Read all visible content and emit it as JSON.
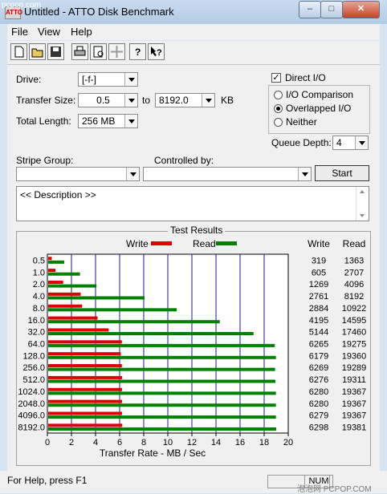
{
  "window": {
    "title": "Untitled - ATTO Disk Benchmark",
    "icon_text": "ATTO",
    "minimize": "–",
    "maximize": "□",
    "close": "✕"
  },
  "watermark_top": "pcpop.com",
  "menu": [
    "File",
    "View",
    "Help"
  ],
  "toolbar": {
    "icons": [
      "new-icon",
      "open-icon",
      "save-icon",
      "print-icon",
      "print-preview-icon",
      "move-icon",
      "help-icon",
      "context-help-icon"
    ]
  },
  "settings": {
    "drive_label": "Drive:",
    "drive_value": "[-f-]",
    "transfer_size_label": "Transfer Size:",
    "transfer_from": "0.5",
    "to_label": "to",
    "transfer_to": "8192.0",
    "kb_label": "KB",
    "total_length_label": "Total Length:",
    "total_length_value": "256 MB",
    "direct_io_label": "Direct I/O",
    "direct_io_checked": true,
    "io_comparison_label": "I/O Comparison",
    "overlapped_io_label": "Overlapped I/O",
    "neither_label": "Neither",
    "selected_mode": "overlapped",
    "queue_depth_label": "Queue Depth:",
    "queue_depth_value": "4",
    "stripe_group_label": "Stripe Group:",
    "stripe_group_value": "",
    "controlled_by_label": "Controlled by:",
    "controlled_by_value": "",
    "start_label": "Start",
    "description": "<< Description >>"
  },
  "results_title": "Test Results",
  "legend": {
    "write_label": "Write",
    "read_label": "Read"
  },
  "columns": {
    "write": "Write",
    "read": "Read"
  },
  "chart_data": {
    "type": "bar",
    "orientation": "horizontal",
    "categories": [
      "0.5",
      "1.0",
      "2.0",
      "4.0",
      "8.0",
      "16.0",
      "32.0",
      "64.0",
      "128.0",
      "256.0",
      "512.0",
      "1024.0",
      "2048.0",
      "4096.0",
      "8192.0"
    ],
    "series": [
      {
        "name": "Write",
        "color": "#e00000",
        "values": [
          0.3,
          0.6,
          1.24,
          2.7,
          2.82,
          4.1,
          5.02,
          6.12,
          6.03,
          6.12,
          6.13,
          6.13,
          6.13,
          6.13,
          6.15
        ]
      },
      {
        "name": "Read",
        "color": "#008000",
        "values": [
          1.33,
          2.64,
          4.0,
          8.0,
          10.67,
          14.25,
          17.05,
          18.82,
          18.91,
          18.84,
          18.86,
          18.91,
          18.91,
          18.91,
          18.93
        ]
      }
    ],
    "write_kb": [
      "319",
      "605",
      "1269",
      "2761",
      "2884",
      "4195",
      "5144",
      "6265",
      "6179",
      "6269",
      "6276",
      "6280",
      "6280",
      "6279",
      "6298"
    ],
    "read_kb": [
      "1363",
      "2707",
      "4096",
      "8192",
      "10922",
      "14595",
      "17460",
      "19275",
      "19360",
      "19289",
      "19311",
      "19367",
      "19367",
      "19367",
      "19381"
    ],
    "xlabel": "Transfer Rate - MB / Sec",
    "xlim": [
      0,
      20
    ],
    "xticks": [
      "0",
      "2",
      "4",
      "6",
      "8",
      "10",
      "12",
      "14",
      "16",
      "18",
      "20"
    ],
    "grid": true
  },
  "status": {
    "text": "For Help, press F1",
    "num": "NUM"
  },
  "watermark_bottom": "泡泡网 PCPOP.COM"
}
